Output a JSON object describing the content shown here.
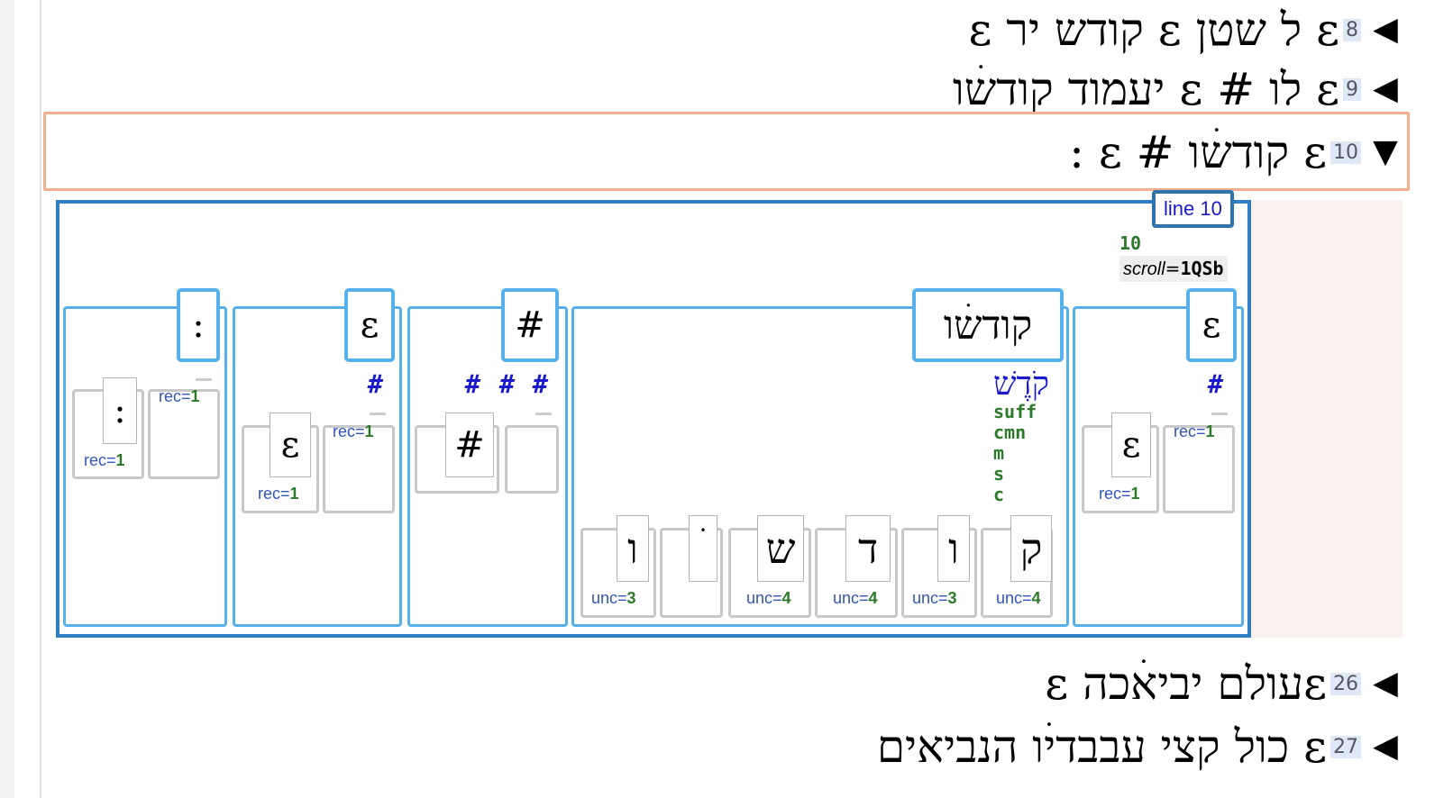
{
  "verses": [
    {
      "arrow": "◀",
      "num": "8",
      "text": "ε ל שטן ε קודש יר ε"
    },
    {
      "arrow": "◀",
      "num": "9",
      "text": "ε לו # ε יעמוד קודשׄו"
    },
    {
      "arrow": "▼",
      "num": "10",
      "text": "ε קודשׄו # ε :"
    },
    {
      "arrow": "◀",
      "num": "26",
      "text": "εעולם יביאׄכה ε"
    },
    {
      "arrow": "◀",
      "num": "27",
      "text": "ε כול קצי עבבדיׄו הנביאים"
    }
  ],
  "panel": {
    "line_tag": "line 10",
    "line_num": "10",
    "scroll_key": "scroll",
    "scroll_eq": "=",
    "scroll_val": "1QSb",
    "words": [
      {
        "label": "ε",
        "hash": "#",
        "signs": [
          {
            "glyph": "ε",
            "attr": "rec",
            "val": "1"
          },
          {
            "glyph": "",
            "attr": "rec",
            "val": "1"
          }
        ]
      },
      {
        "label": "קודשׄו",
        "lexeme": "קֹדֶשׁ",
        "features": [
          "suff",
          "cmn",
          "m",
          "s",
          "c"
        ],
        "signs": [
          {
            "glyph": "ק",
            "attr": "unc",
            "val": "4"
          },
          {
            "glyph": "ו",
            "attr": "unc",
            "val": "3"
          },
          {
            "glyph": "ד",
            "attr": "unc",
            "val": "4"
          },
          {
            "glyph": "ש",
            "attr": "unc",
            "val": "4"
          },
          {
            "glyph": "ׄ",
            "attr": "",
            "val": ""
          },
          {
            "glyph": "ו",
            "attr": "unc",
            "val": "3"
          }
        ]
      },
      {
        "label": "#",
        "hashes": [
          "#",
          "#",
          "#"
        ],
        "signs": [
          {
            "glyph": "#"
          },
          {
            "glyph": ""
          }
        ]
      },
      {
        "label": "ε",
        "hash": "#",
        "signs": [
          {
            "glyph": "ε",
            "attr": "rec",
            "val": "1"
          },
          {
            "glyph": "",
            "attr": "rec",
            "val": "1"
          }
        ]
      },
      {
        "label": ":",
        "signs": [
          {
            "glyph": ":",
            "attr": "rec",
            "val": "1"
          },
          {
            "glyph": "",
            "attr": "rec",
            "val": "1"
          }
        ]
      }
    ]
  }
}
